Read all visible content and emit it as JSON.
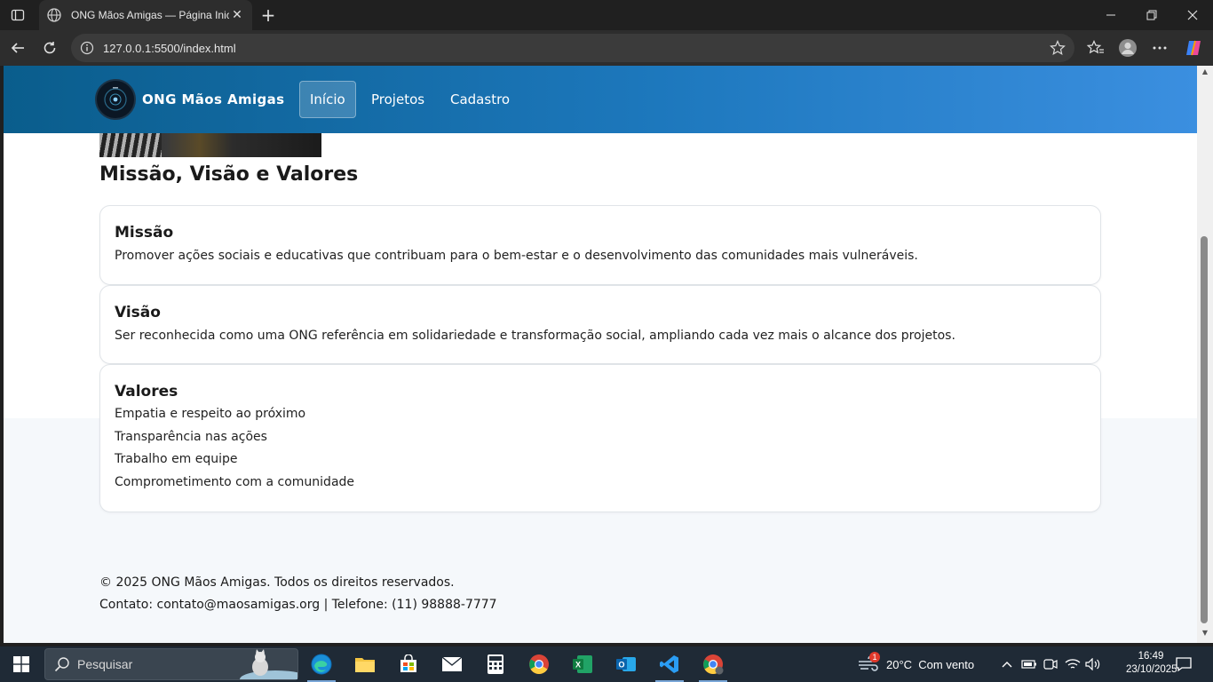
{
  "browser": {
    "tab_title": "ONG Mãos Amigas — Página Inicial",
    "url": "127.0.0.1:5500/index.html"
  },
  "site": {
    "brand": "ONG Mãos Amigas",
    "nav": [
      {
        "label": "Início",
        "active": true
      },
      {
        "label": "Projetos",
        "active": false
      },
      {
        "label": "Cadastro",
        "active": false
      }
    ]
  },
  "main": {
    "section_title": "Missão, Visão e Valores",
    "cards": {
      "missao": {
        "title": "Missão",
        "text": "Promover ações sociais e educativas que contribuam para o bem-estar e o desenvolvimento das comunidades mais vulneráveis."
      },
      "visao": {
        "title": "Visão",
        "text": "Ser reconhecida como uma ONG referência em solidariedade e transformação social, ampliando cada vez mais o alcance dos projetos."
      },
      "valores": {
        "title": "Valores",
        "items": [
          "Empatia e respeito ao próximo",
          "Transparência nas ações",
          "Trabalho em equipe",
          "Comprometimento com a comunidade"
        ]
      }
    }
  },
  "footer": {
    "copyright": "© 2025 ONG Mãos Amigas. Todos os direitos reservados.",
    "contact": "Contato: contato@maosamigas.org | Telefone: (11) 98888-7777"
  },
  "taskbar": {
    "search_placeholder": "Pesquisar",
    "weather": "20°C  Com vento",
    "weather_badge": "1",
    "time": "16:49",
    "date": "23/10/2025",
    "apps": [
      "edge-icon",
      "file-explorer-icon",
      "store-icon",
      "mail-icon",
      "calculator-icon",
      "chrome-icon",
      "excel-icon",
      "outlook-icon",
      "vscode-icon",
      "chrome-alt-icon"
    ]
  },
  "colors": {
    "header_start": "#0a5d8c",
    "header_end": "#3b8fe0",
    "page_bg": "#f5f8fb"
  }
}
